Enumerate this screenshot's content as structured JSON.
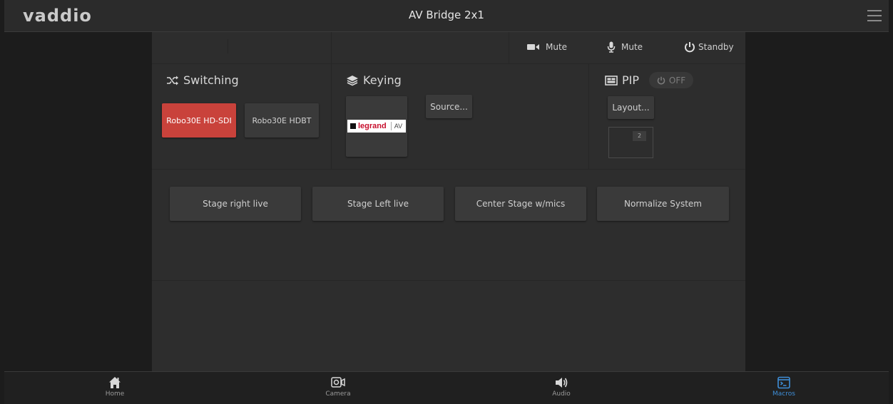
{
  "header": {
    "logo": "vaddio",
    "title": "AV Bridge 2x1"
  },
  "controls": {
    "video_mute": "Mute",
    "audio_mute": "Mute",
    "standby": "Standby"
  },
  "switching": {
    "title": "Switching",
    "inputs": [
      {
        "label": "Robo30E HD-SDI",
        "active": true
      },
      {
        "label": "Robo30E HDBT",
        "active": false
      }
    ]
  },
  "keying": {
    "title": "Keying",
    "source_button": "Source...",
    "logo_brand": "legrand",
    "logo_suffix": "AV"
  },
  "pip": {
    "title": "PIP",
    "state": "OFF",
    "layout_button": "Layout...",
    "preview_number": "2"
  },
  "macros": [
    {
      "label": "Stage right live"
    },
    {
      "label": "Stage Left live"
    },
    {
      "label": "Center Stage w/mics"
    },
    {
      "label": "Normalize System"
    }
  ],
  "nav": [
    {
      "label": "Home",
      "icon": "home-icon",
      "active": false
    },
    {
      "label": "Camera",
      "icon": "camera-icon",
      "active": false
    },
    {
      "label": "Audio",
      "icon": "speaker-icon",
      "active": false
    },
    {
      "label": "Macros",
      "icon": "macros-icon",
      "active": true
    }
  ],
  "colors": {
    "active_input": "#c9423b",
    "active_nav": "#3e8ed8"
  }
}
